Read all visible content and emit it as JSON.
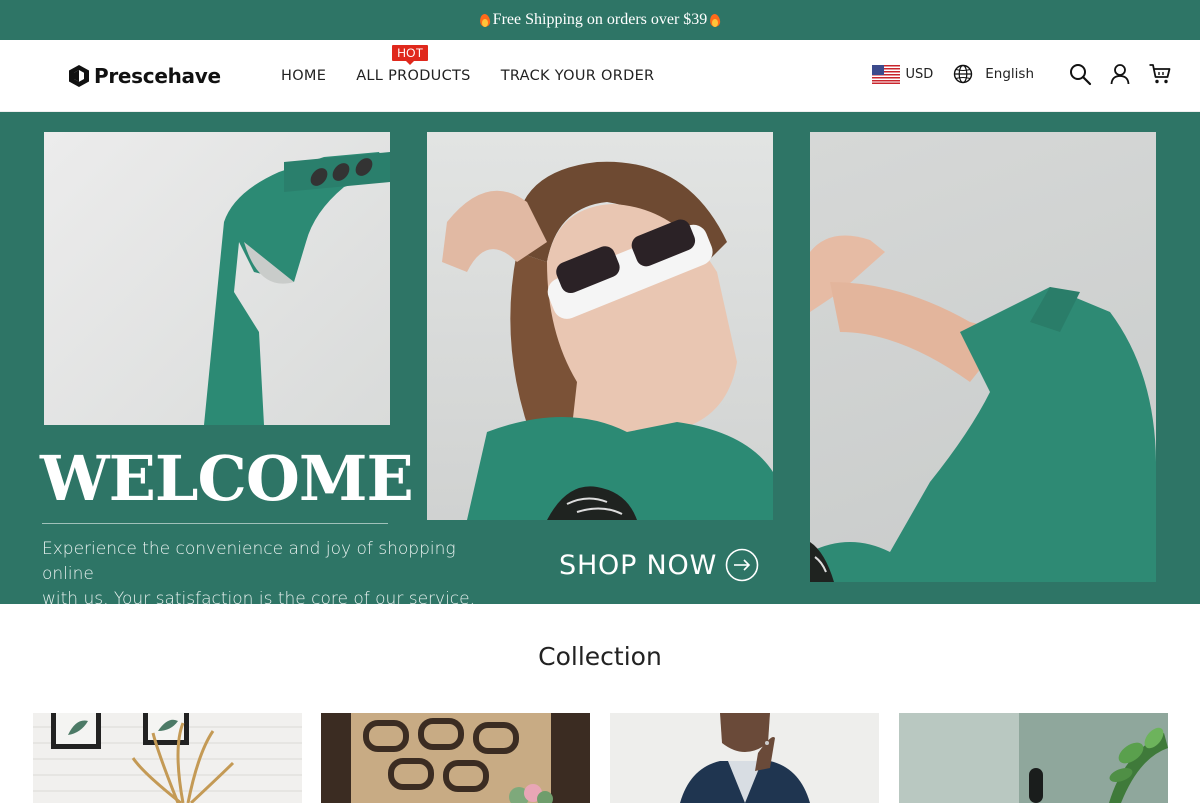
{
  "announcement": {
    "text": "Free Shipping on orders over $39"
  },
  "header": {
    "brand": "Prescehave",
    "nav": [
      {
        "label": "HOME"
      },
      {
        "label": "ALL PRODUCTS",
        "badge": "HOT"
      },
      {
        "label": "TRACK YOUR ORDER"
      }
    ],
    "currency": "USD",
    "language": "English",
    "icons": [
      "flag-us-icon",
      "globe-icon",
      "search-icon",
      "user-icon",
      "cart-icon"
    ]
  },
  "hero": {
    "title": "WELCOME",
    "tagline_line1": "Experience the convenience and joy of shopping online",
    "tagline_line2": "with us. Your satisfaction is the core of our service.",
    "cta": "SHOP NOW",
    "background_color": "#2e7566"
  },
  "collection": {
    "title": "Collection",
    "items": [
      {
        "image": "home-decor-image"
      },
      {
        "image": "pattern-image"
      },
      {
        "image": "mens-fashion-image"
      },
      {
        "image": "plant-image"
      }
    ]
  },
  "colors": {
    "accent": "#2e7566",
    "badge": "#e0281c"
  }
}
